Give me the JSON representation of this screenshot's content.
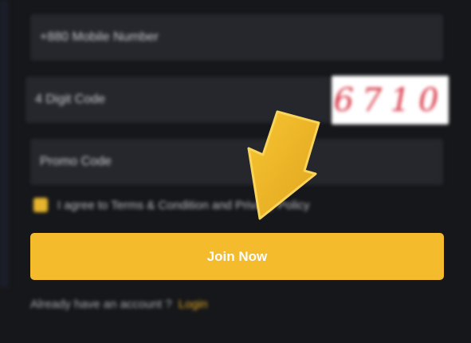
{
  "form": {
    "mobile_placeholder": "+880 Mobile Number",
    "digit_code_placeholder": "4 Digit Code",
    "captcha_text": "6710",
    "promo_placeholder": "Promo Code",
    "terms_label": "I agree to Terms & Condition and Privacy Policy",
    "join_label": "Join Now",
    "account_prompt": "Already have an account ?",
    "login_label": "Login"
  },
  "icons": {
    "annotation_arrow": "arrow-down-left-icon",
    "checkbox": "checkbox-checked-icon"
  },
  "colors": {
    "accent": "#f4bb2c",
    "background": "#16171a",
    "field": "#25272d",
    "captcha": "#d93a4a"
  }
}
